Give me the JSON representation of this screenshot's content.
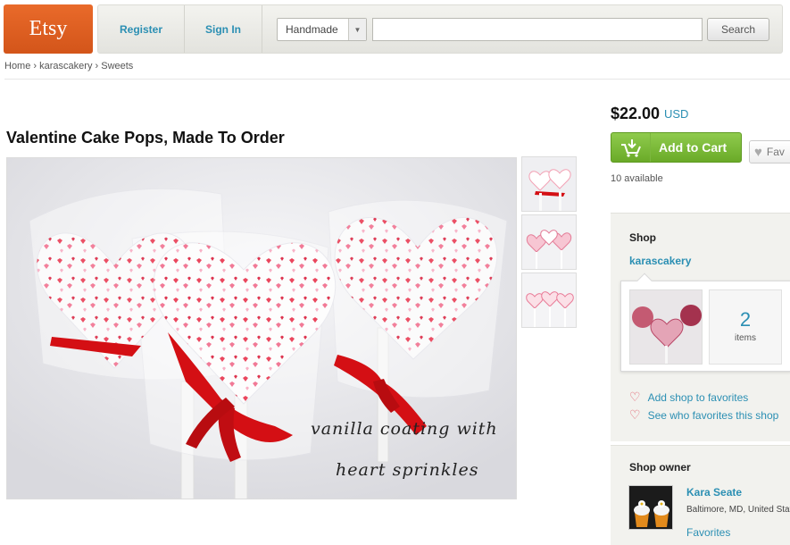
{
  "header": {
    "logo": "Etsy",
    "register": "Register",
    "sign_in": "Sign In",
    "category": "Handmade",
    "search_value": "",
    "search_button": "Search"
  },
  "breadcrumb": [
    "Home",
    "karascakery",
    "Sweets"
  ],
  "breadcrumb_separator": "›",
  "listing": {
    "title": "Valentine Cake Pops, Made To Order",
    "image_caption_line1": "vanilla coating with",
    "image_caption_line2": "heart sprinkles"
  },
  "purchase": {
    "price": "$22.00",
    "currency": "USD",
    "add_to_cart": "Add to Cart",
    "favorite": "Fav",
    "available": "10 available"
  },
  "shop": {
    "heading": "Shop",
    "name": "karascakery",
    "item_count": "2",
    "items_label": "items",
    "add_favorites": "Add shop to favorites",
    "see_favorites": "See who favorites this shop"
  },
  "owner": {
    "heading": "Shop owner",
    "name": "Kara Seate",
    "location": "Baltimore, MD, United States",
    "favorites_link": "Favorites"
  },
  "colors": {
    "brand_orange": "#d95a1e",
    "link_blue": "#2b8fb3",
    "cart_green": "#7dbb3b",
    "ribbon_red": "#d40f14"
  }
}
